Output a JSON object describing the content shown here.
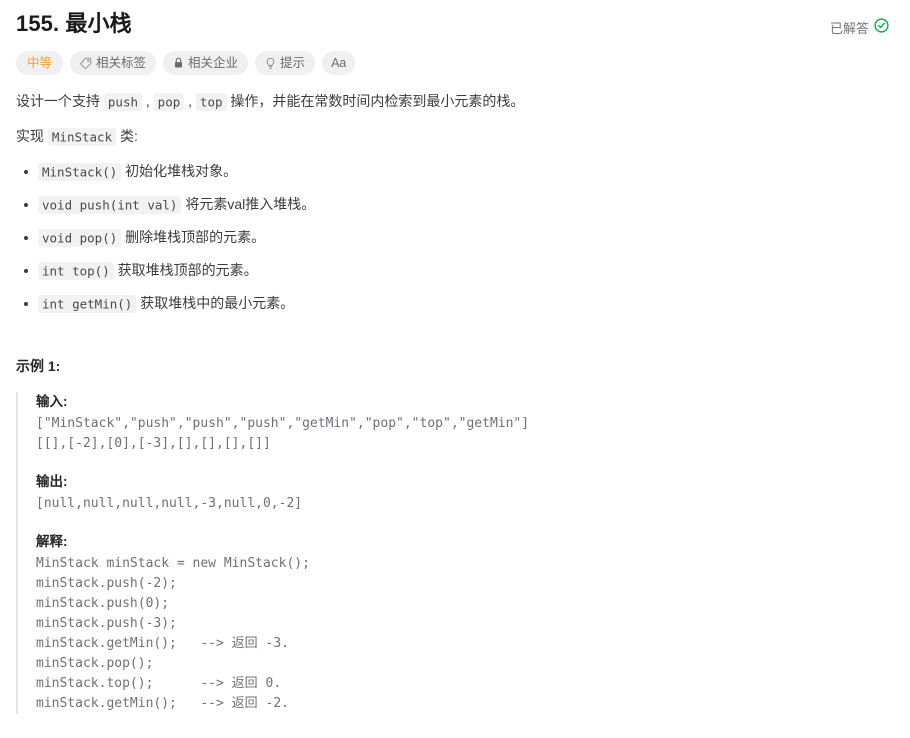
{
  "header": {
    "title": "155. 最小栈",
    "status_label": "已解答",
    "status_icon": "check-circle-icon",
    "status_color": "#00b04f"
  },
  "tags": [
    {
      "label": "中等",
      "icon": null,
      "name": "difficulty-badge",
      "color": "#e8a33d"
    },
    {
      "label": "相关标签",
      "icon": "tag-icon",
      "name": "related-topics-button"
    },
    {
      "label": "相关企业",
      "icon": "lock-icon",
      "name": "related-companies-button"
    },
    {
      "label": "提示",
      "icon": "lightbulb-icon",
      "name": "hints-button"
    },
    {
      "label": "Aa",
      "icon": null,
      "name": "font-settings-button"
    }
  ],
  "description": {
    "line1_pre": "设计一个支持 ",
    "code_push": "push",
    "sep1": " , ",
    "code_pop": "pop",
    "sep2": " , ",
    "code_top": "top",
    "line1_post": " 操作，并能在常数时间内检索到最小元素的栈。",
    "line2_pre": "实现 ",
    "code_minstack": "MinStack",
    "line2_post": " 类:"
  },
  "methods": [
    {
      "code": "MinStack()",
      "text": " 初始化堆栈对象。"
    },
    {
      "code": "void push(int val)",
      "text": " 将元素val推入堆栈。"
    },
    {
      "code": "void pop()",
      "text": " 删除堆栈顶部的元素。"
    },
    {
      "code": "int top()",
      "text": " 获取堆栈顶部的元素。"
    },
    {
      "code": "int getMin()",
      "text": " 获取堆栈中的最小元素。"
    }
  ],
  "example": {
    "heading": "示例 1:",
    "input_label": "输入:",
    "input_code": "[\"MinStack\",\"push\",\"push\",\"push\",\"getMin\",\"pop\",\"top\",\"getMin\"]\n[[],[-2],[0],[-3],[],[],[],[]]",
    "output_label": "输出:",
    "output_code": "[null,null,null,null,-3,null,0,-2]",
    "explain_label": "解释:",
    "explain_code": "MinStack minStack = new MinStack();\nminStack.push(-2);\nminStack.push(0);\nminStack.push(-3);\nminStack.getMin();   --> 返回 -3.\nminStack.pop();\nminStack.top();      --> 返回 0.\nminStack.getMin();   --> 返回 -2."
  }
}
